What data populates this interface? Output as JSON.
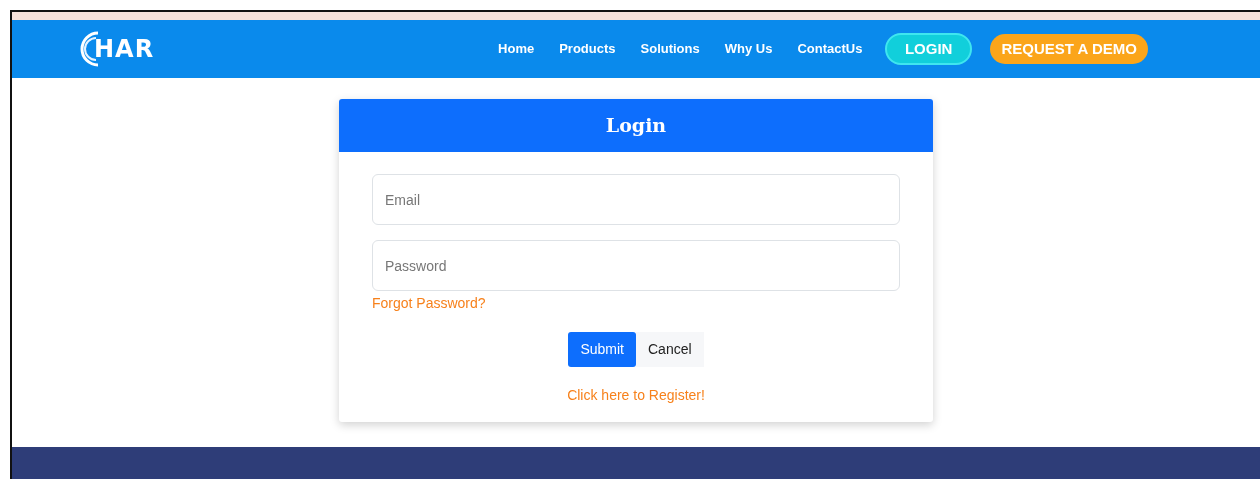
{
  "navbar": {
    "logo_text": "HAR",
    "links": [
      {
        "label": "Home"
      },
      {
        "label": "Products"
      },
      {
        "label": "Solutions"
      },
      {
        "label": "Why Us"
      },
      {
        "label": "ContactUs"
      }
    ],
    "buttons": [
      {
        "label": "LOGIN",
        "kind": "login"
      },
      {
        "label": "REQUEST A DEMO",
        "kind": "demo"
      }
    ]
  },
  "login_card": {
    "title": "Login",
    "fields": [
      {
        "placeholder": "Email"
      },
      {
        "placeholder": "Password"
      }
    ],
    "forgot_link": "Forgot Password?",
    "buttons": [
      {
        "label": "Submit",
        "kind": "primary"
      },
      {
        "label": "Cancel",
        "kind": "secondary"
      }
    ],
    "register_link": "Click here to Register!"
  }
}
